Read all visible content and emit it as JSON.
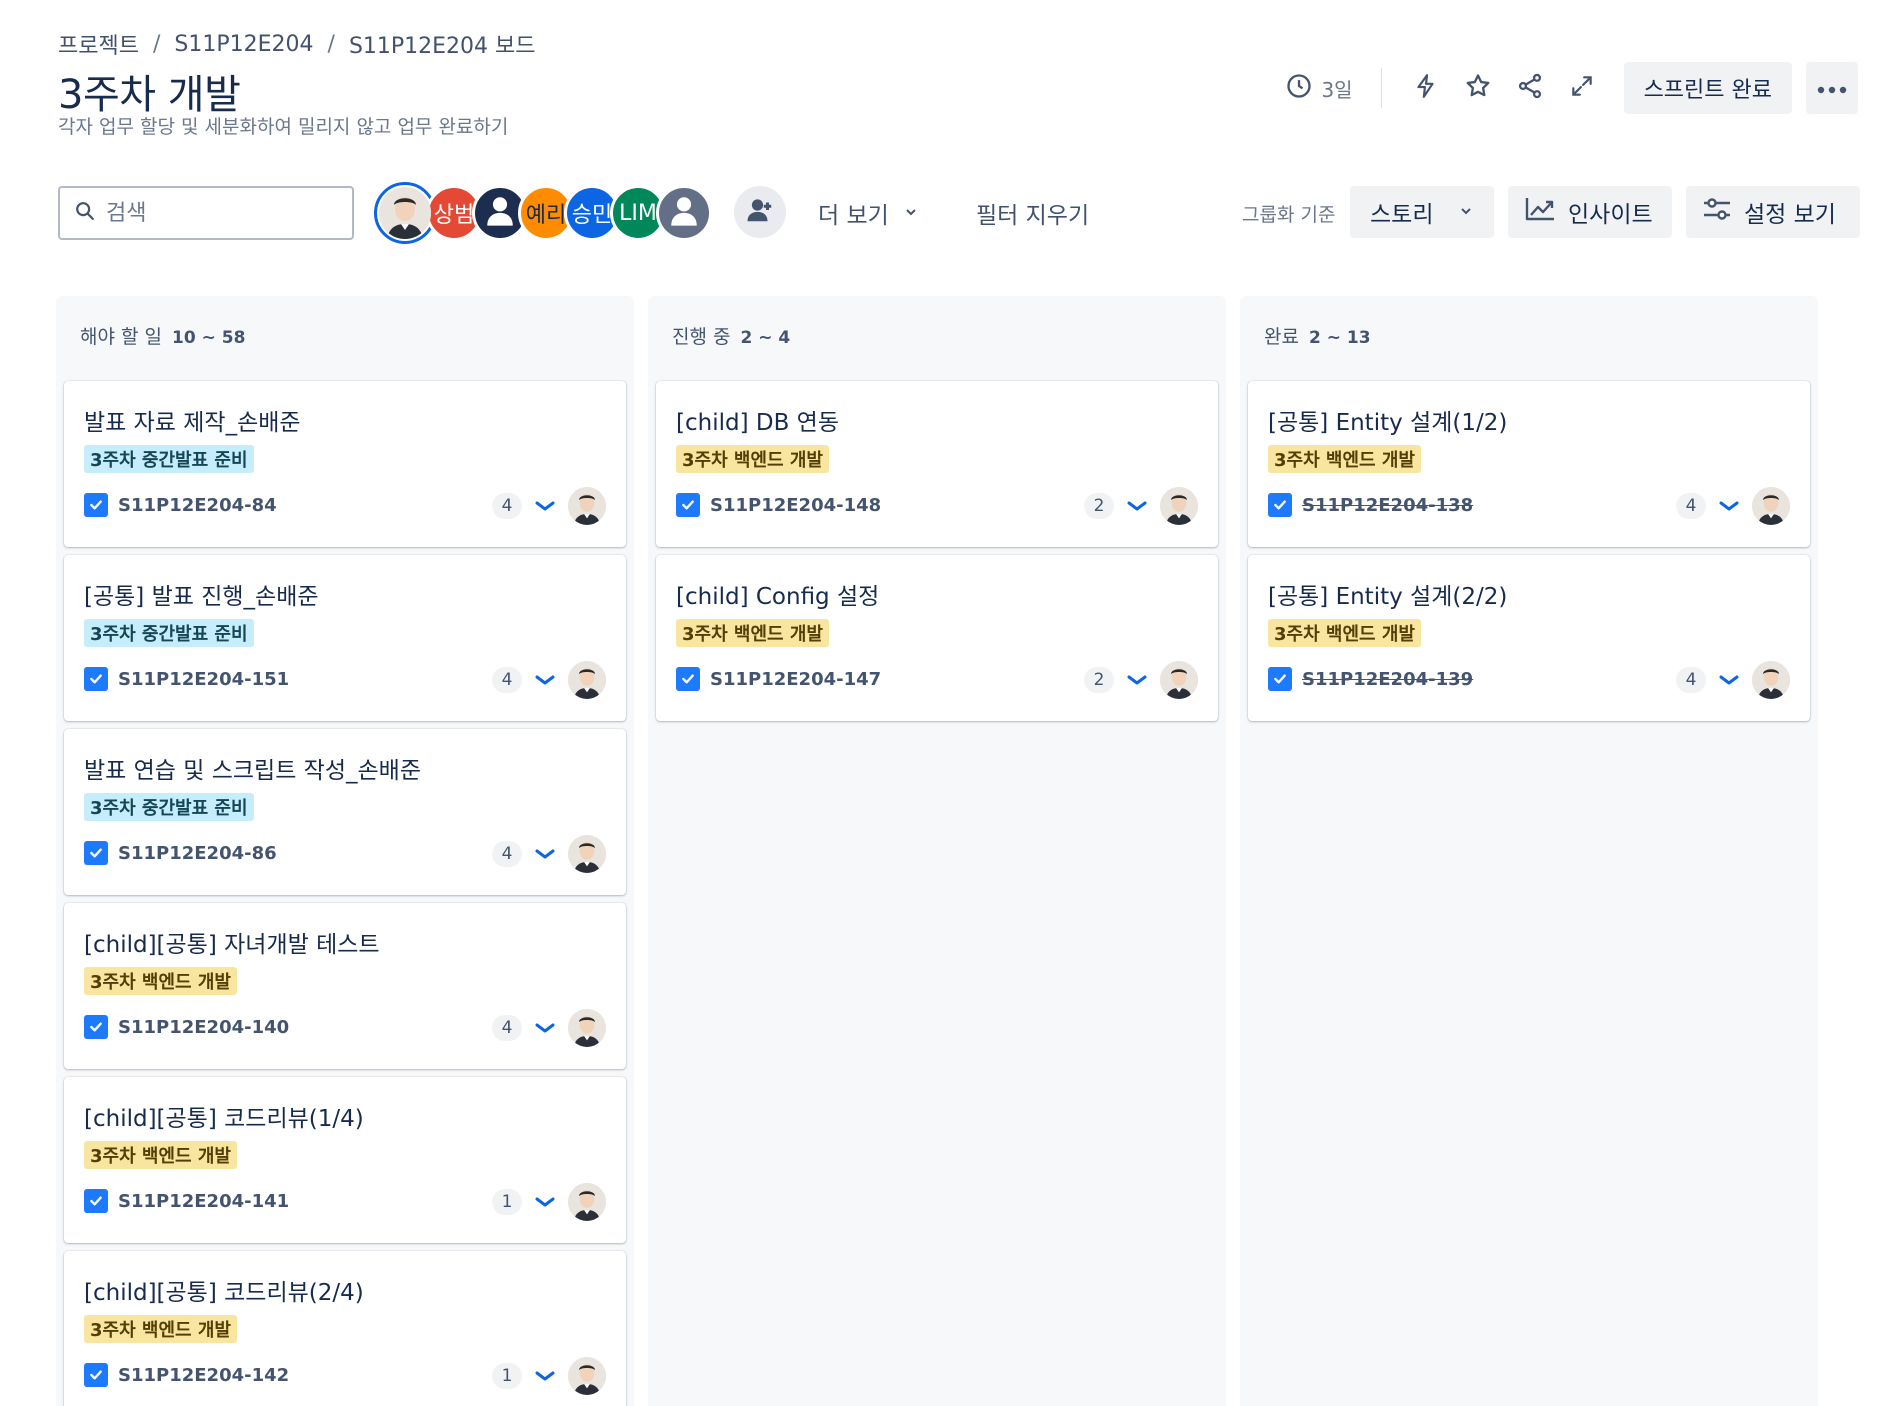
{
  "breadcrumb": [
    "프로젝트",
    "S11P12E204",
    "S11P12E204 보드"
  ],
  "breadcrumb_sep": "/",
  "title": "3주차 개발",
  "subtitle": "각자 업무 할당 및 세분화하여 밀리지 않고 업무 완료하기",
  "header": {
    "days_left": "3일",
    "complete_sprint": "스프린트 완료",
    "icons": [
      "clock-icon",
      "bolt-icon",
      "star-icon",
      "share-icon",
      "expand-icon",
      "more-icon"
    ]
  },
  "toolbar": {
    "search_placeholder": "검색",
    "avatars": [
      {
        "label": "",
        "color": "#ffffff",
        "kind": "photo"
      },
      {
        "label": "상범",
        "color": "#e34935"
      },
      {
        "label": "",
        "color": "#1d2d4f",
        "kind": "default"
      },
      {
        "label": "예리",
        "color": "#ff8b00"
      },
      {
        "label": "승민",
        "color": "#0c66e4"
      },
      {
        "label": "LIM",
        "color": "#00875a"
      },
      {
        "label": "",
        "color": "#626f86",
        "kind": "default"
      }
    ],
    "more_label": "더 보기",
    "clear_filter": "필터 지우기",
    "group_by_label": "그룹화 기준",
    "group_by_value": "스토리",
    "insight": "인사이트",
    "view_settings": "설정 보기"
  },
  "columns": [
    {
      "title": "해야 할 일",
      "count": "10 ~ 58",
      "cards": [
        {
          "title": "발표 자료 제작_손배준",
          "epic": "3주차 중간발표 준비",
          "epic_color": "teal",
          "key": "S11P12E204-84",
          "points": "4",
          "done": false
        },
        {
          "title": "[공통] 발표 진행_손배준",
          "epic": "3주차 중간발표 준비",
          "epic_color": "teal",
          "key": "S11P12E204-151",
          "points": "4",
          "done": false
        },
        {
          "title": "발표 연습 및 스크립트 작성_손배준",
          "epic": "3주차 중간발표 준비",
          "epic_color": "teal",
          "key": "S11P12E204-86",
          "points": "4",
          "done": false
        },
        {
          "title": "[child][공통] 자녀개발 테스트",
          "epic": "3주차 백엔드 개발",
          "epic_color": "yellow",
          "key": "S11P12E204-140",
          "points": "4",
          "done": false
        },
        {
          "title": "[child][공통] 코드리뷰(1/4)",
          "epic": "3주차 백엔드 개발",
          "epic_color": "yellow",
          "key": "S11P12E204-141",
          "points": "1",
          "done": false
        },
        {
          "title": "[child][공통] 코드리뷰(2/4)",
          "epic": "3주차 백엔드 개발",
          "epic_color": "yellow",
          "key": "S11P12E204-142",
          "points": "1",
          "done": false
        }
      ]
    },
    {
      "title": "진행 중",
      "count": "2 ~ 4",
      "cards": [
        {
          "title": "[child] DB 연동",
          "epic": "3주차 백엔드 개발",
          "epic_color": "yellow",
          "key": "S11P12E204-148",
          "points": "2",
          "done": false
        },
        {
          "title": "[child] Config 설정",
          "epic": "3주차 백엔드 개발",
          "epic_color": "yellow",
          "key": "S11P12E204-147",
          "points": "2",
          "done": false
        }
      ]
    },
    {
      "title": "완료",
      "count": "2 ~ 13",
      "cards": [
        {
          "title": "[공통] Entity 설계(1/2)",
          "epic": "3주차 백엔드 개발",
          "epic_color": "yellow",
          "key": "S11P12E204-138",
          "points": "4",
          "done": true
        },
        {
          "title": "[공통] Entity 설계(2/2)",
          "epic": "3주차 백엔드 개발",
          "epic_color": "yellow",
          "key": "S11P12E204-139",
          "points": "4",
          "done": true
        }
      ]
    }
  ]
}
